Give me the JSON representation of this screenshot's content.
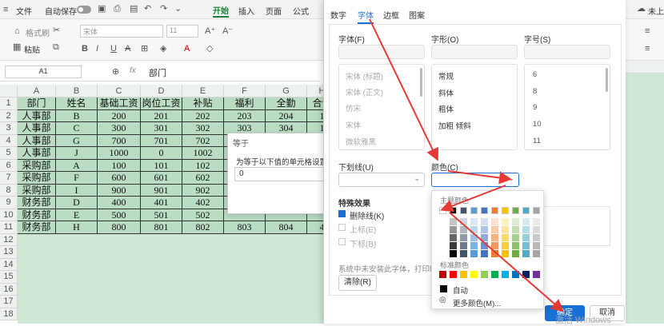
{
  "ribbon": {
    "file": "文件",
    "autosave": "自动保存",
    "tabs": [
      "开始",
      "插入",
      "页面",
      "公式"
    ],
    "format_painter": "格式刷",
    "paste": "粘贴",
    "font_name": "宋体",
    "font_size": "11",
    "right_label": "未上"
  },
  "formula": {
    "name_box": "A1",
    "fx": "fx",
    "content": "部门"
  },
  "grid": {
    "columns": [
      "A",
      "B",
      "C",
      "D",
      "E",
      "F",
      "G",
      "H"
    ],
    "rows": [
      "1",
      "2",
      "3",
      "4",
      "5",
      "6",
      "7",
      "8",
      "9",
      "10",
      "11",
      "12",
      "13",
      "14",
      "15",
      "16",
      "17",
      "18"
    ],
    "data": [
      [
        "部门",
        "姓名",
        "基础工资",
        "岗位工资",
        "补贴",
        "福利",
        "全勤",
        "合计"
      ],
      [
        "人事部",
        "B",
        "200",
        "201",
        "202",
        "203",
        "204",
        "1"
      ],
      [
        "人事部",
        "C",
        "300",
        "301",
        "302",
        "303",
        "304",
        "1"
      ],
      [
        "人事部",
        "G",
        "700",
        "701",
        "702",
        "",
        "",
        ""
      ],
      [
        "人事部",
        "J",
        "1000",
        "0",
        "1002",
        "",
        "",
        ""
      ],
      [
        "采购部",
        "A",
        "100",
        "101",
        "102",
        "",
        "",
        ""
      ],
      [
        "采购部",
        "F",
        "600",
        "601",
        "602",
        "",
        "",
        ""
      ],
      [
        "采购部",
        "I",
        "900",
        "901",
        "902",
        "",
        "",
        ""
      ],
      [
        "财务部",
        "D",
        "400",
        "401",
        "402",
        "",
        "",
        ""
      ],
      [
        "财务部",
        "E",
        "500",
        "501",
        "502",
        "",
        "",
        ""
      ],
      [
        "财务部",
        "H",
        "800",
        "801",
        "802",
        "803",
        "804",
        "4"
      ]
    ]
  },
  "small_dialog": {
    "title": "等于",
    "prompt": "为等于以下值的单元格设置",
    "value": "0"
  },
  "font_dialog": {
    "tabs": [
      "数字",
      "字体",
      "边框",
      "图案"
    ],
    "font_label": "字体(F)",
    "style_label": "字形(O)",
    "size_label": "字号(S)",
    "fonts": [
      "宋体 (标题)",
      "宋体 (正文)",
      "仿宋",
      "宋体",
      "微软雅黑"
    ],
    "styles": [
      "常规",
      "斜体",
      "粗体",
      "加粗 倾斜"
    ],
    "sizes": [
      "6",
      "8",
      "9",
      "10",
      "11"
    ],
    "underline_label": "下划线(U)",
    "color_label": "颜色(C)",
    "effects_label": "特殊效果",
    "strike": "删除线(K)",
    "sup": "上标(E)",
    "sub": "下标(B)",
    "note": "系统中未安装此字体，打印时",
    "clear": "清除(R)",
    "ok": "确定",
    "cancel": "取消"
  },
  "palette": {
    "theme_label": "主题颜色",
    "standard_label": "标准颜色",
    "auto": "自动",
    "more": "更多颜色(M)...",
    "theme_top": [
      "#ffffff",
      "#000000",
      "#44546a",
      "#5b9bd5",
      "#4472c4",
      "#ed7d31",
      "#ffc000",
      "#70ad47",
      "#4bacc6",
      "#a5a5a5",
      "#264478",
      "#9e480e"
    ],
    "standard": [
      "#c00000",
      "#ff0000",
      "#ffc000",
      "#ffff00",
      "#92d050",
      "#00b050",
      "#00b0f0",
      "#0070c0",
      "#002060",
      "#7030a0",
      "#000000",
      "#7f7f7f"
    ]
  },
  "watermark": "激活 Windows"
}
